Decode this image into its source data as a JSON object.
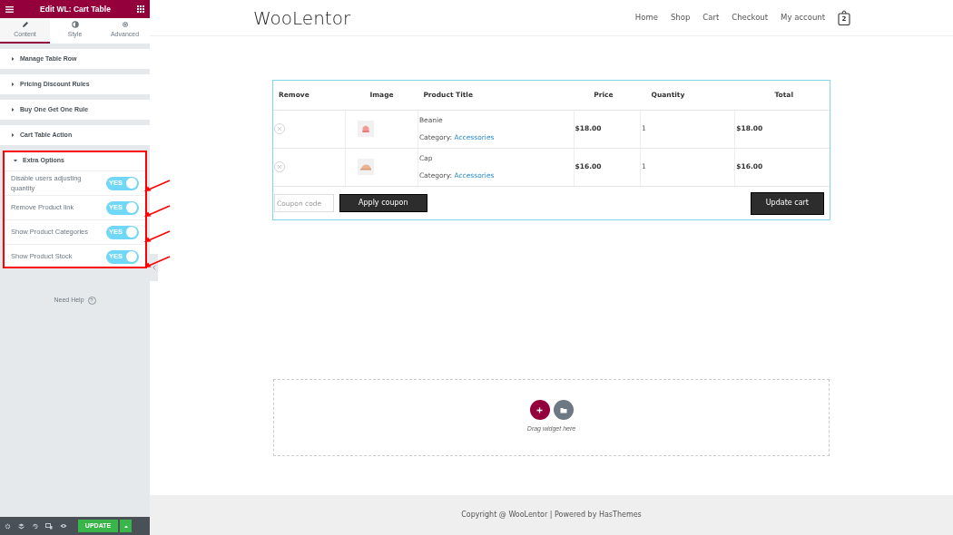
{
  "editor": {
    "title": "Edit WL: Cart Table",
    "tabs": [
      {
        "label": "Content",
        "selected": true
      },
      {
        "label": "Style",
        "selected": false
      },
      {
        "label": "Advanced",
        "selected": false
      }
    ],
    "sections": [
      {
        "label": "Manage Table Row",
        "expanded": false
      },
      {
        "label": "Pricing Discount Rules",
        "expanded": false
      },
      {
        "label": "Buy One Get One Rule",
        "expanded": false
      },
      {
        "label": "Cart Table Action",
        "expanded": false
      },
      {
        "label": "Extra Options",
        "expanded": true,
        "highlighted": true,
        "options": [
          {
            "label": "Disable users adjusting quantity",
            "on": true,
            "toggle_text": "YES"
          },
          {
            "label": "Remove Product link",
            "on": true,
            "toggle_text": "YES"
          },
          {
            "label": "Show Product Categories",
            "on": true,
            "toggle_text": "YES"
          },
          {
            "label": "Show Product Stock",
            "on": true,
            "toggle_text": "YES"
          }
        ]
      }
    ],
    "help": "Need Help",
    "help_glyph": "?",
    "update_button": "UPDATE"
  },
  "site": {
    "logo": "WooLentor",
    "nav": [
      "Home",
      "Shop",
      "Cart",
      "Checkout",
      "My account"
    ],
    "cart_count": "2"
  },
  "cart": {
    "columns": [
      "Remove",
      "Image",
      "Product Title",
      "Price",
      "Quantity",
      "Total"
    ],
    "rows": [
      {
        "product": "Beanie",
        "category_label": "Category:",
        "category": "Accessories",
        "price": "$18.00",
        "quantity": "1",
        "total": "$18.00"
      },
      {
        "product": "Cap",
        "category_label": "Category:",
        "category": "Accessories",
        "price": "$16.00",
        "quantity": "1",
        "total": "$16.00"
      }
    ],
    "coupon_placeholder": "Coupon code",
    "apply_button": "Apply coupon",
    "update_button": "Update cart"
  },
  "dropzone": {
    "hint": "Drag widget here"
  },
  "footer": {
    "text": "Copyright @ WooLentor | Powered by HasThemes"
  }
}
